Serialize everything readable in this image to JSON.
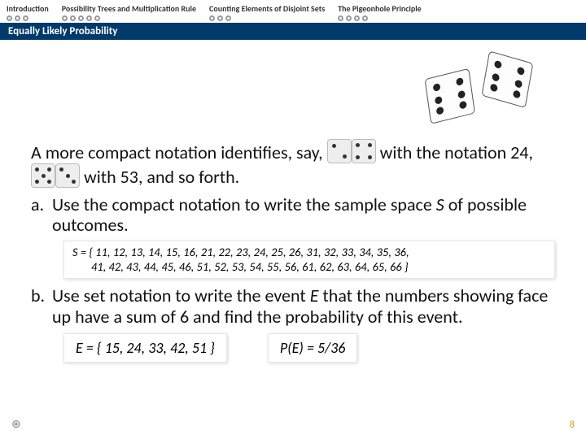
{
  "nav": {
    "items": [
      {
        "label": "Introduction",
        "dots": 3
      },
      {
        "label": "Possibility Trees and Multiplication Rule",
        "dots": 5
      },
      {
        "label": "Counting Elements of Disjoint Sets",
        "dots": 3
      },
      {
        "label": "The Pigeonhole Principle",
        "dots": 4
      }
    ]
  },
  "subhead": "Equally Likely Probability",
  "para": {
    "t1": "A more compact notation identifies, say, ",
    "t2": " with the notation 24, ",
    "t3": " with 53, and so forth."
  },
  "qa": {
    "marker": "a.",
    "text": "Use the compact notation to write the sample space ",
    "svar": "S",
    "text2": " of possible outcomes."
  },
  "sbox": {
    "svar": "S",
    "eq": " = { 11, 12, 13, 14, 15, 16, 21, 22, 23, 24, 25, 26, 31, 32, 33, 34, 35, 36,",
    "line2": "41, 42, 43, 44, 45, 46, 51, 52, 53, 54, 55, 56, 61, 62, 63, 64, 65, 66 }"
  },
  "qb": {
    "marker": "b.",
    "text": "Use set notation to write the event ",
    "evar": "E",
    "text2": " that the numbers showing face up have a sum of 6 and find the probability of this event."
  },
  "ebox1": {
    "evar": "E",
    "eq": " = { 15, 24, 33, 42, 51 }"
  },
  "ebox2": {
    "pvar": "P",
    "open": "(",
    "evar": "E",
    "eq": ") = 5/36"
  },
  "pagenum": "8",
  "corner": "⊕"
}
